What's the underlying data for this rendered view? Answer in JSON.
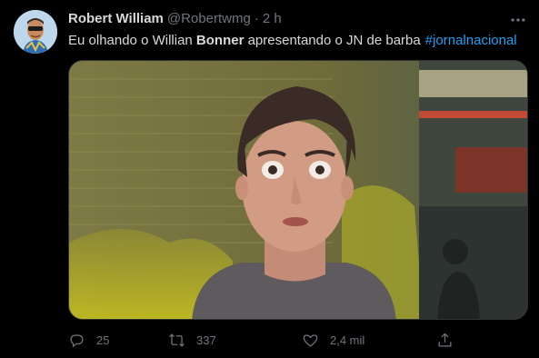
{
  "tweet": {
    "author_name": "Robert William",
    "author_handle": "@Robertwmg",
    "separator": "·",
    "time": "2 h",
    "text_before": "Eu olhando o Willian ",
    "text_bold": "Bonner",
    "text_after": " apresentando o JN de barba",
    "hashtag": "#jornalnacional"
  },
  "actions": {
    "reply_count": "25",
    "retweet_count": "337",
    "like_count": "2,4 mil"
  },
  "icons": {
    "more": "more-icon",
    "reply": "reply-icon",
    "retweet": "retweet-icon",
    "like": "like-icon",
    "share": "share-icon"
  },
  "colors": {
    "background": "#000000",
    "text": "#d9d9d9",
    "secondary": "#6e767d",
    "link": "#1da1f2",
    "border": "#2f3336"
  }
}
